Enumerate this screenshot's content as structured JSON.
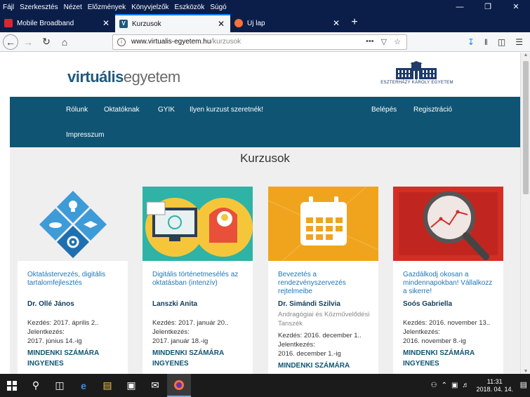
{
  "menubar": {
    "items": [
      "Fájl",
      "Szerkesztés",
      "Nézet",
      "Előzmények",
      "Könyvjelzők",
      "Eszközök",
      "Súgó"
    ]
  },
  "tabs": [
    {
      "label": "Mobile Broadband",
      "favicon_color": "#d8282f"
    },
    {
      "label": "Kurzusok",
      "favicon_color": "#1e5a7c"
    },
    {
      "label": "Új lap",
      "favicon_color": "#ff7139"
    }
  ],
  "address": {
    "host": "www.virtualis-egyetem.hu",
    "path": "/kurzusok"
  },
  "site": {
    "logo_part1": "virtuális",
    "logo_part2": "egyetem",
    "university": "ESZTERHÁZY KÁROLY EGYETEM",
    "nav": {
      "rolunk": "Rólunk",
      "oktatoknak": "Oktatóknak",
      "gyik": "GYIK",
      "ilyen": "Ilyen kurzust szeretnék!",
      "impresszum": "Impresszum",
      "belepes": "Belépés",
      "regisztracio": "Regisztráció"
    },
    "page_title": "Kurzusok"
  },
  "courses": [
    {
      "title": "Oktatástervezés, digitális tartalomfejlesztés",
      "teacher": "Dr. Ollé János",
      "start": "Kezdés: 2017. április 2..",
      "enroll_label": "Jelentkezés:",
      "enroll_date": "2017. június 14.-ig",
      "tag1": "MINDENKI SZÁMÁRA",
      "tag2": "INGYENES"
    },
    {
      "title": "Digitális történetmesélés az oktatásban (intenzív)",
      "teacher": "Lanszki Anita",
      "start": "Kezdés: 2017. január 20..",
      "enroll_label": "Jelentkezés:",
      "enroll_date": "2017. január 18.-ig",
      "tag1": "MINDENKI SZÁMÁRA",
      "tag2": "INGYENES"
    },
    {
      "title": "Bevezetés a rendezvényszervezés rejtelmeibe",
      "teacher": "Dr. Simándi Szilvia",
      "dept": "Andragógiai és Közművelődési Tanszék",
      "start": "Kezdés: 2016. december 1..",
      "enroll_label": "Jelentkezés:",
      "enroll_date": "2016. december 1.-ig",
      "tag1": "MINDENKI SZÁMÁRA"
    },
    {
      "title": "Gazdálkodj okosan a mindennapokban! Vállalkozz a sikerre!",
      "teacher": "Soós Gabriella",
      "start": "Kezdés: 2016. november 13..",
      "enroll_label": "Jelentkezés:",
      "enroll_date": "2016. november 8.-ig",
      "tag1": "MINDENKI SZÁMÁRA",
      "tag2": "INGYENES"
    }
  ],
  "taskbar": {
    "time": "11:31",
    "date": "2018. 04. 14."
  },
  "colors": {
    "brand": "#0f5473",
    "link": "#1e77b8",
    "taskbar": "#1b1b1b",
    "titlebar": "#0b1e4a"
  }
}
